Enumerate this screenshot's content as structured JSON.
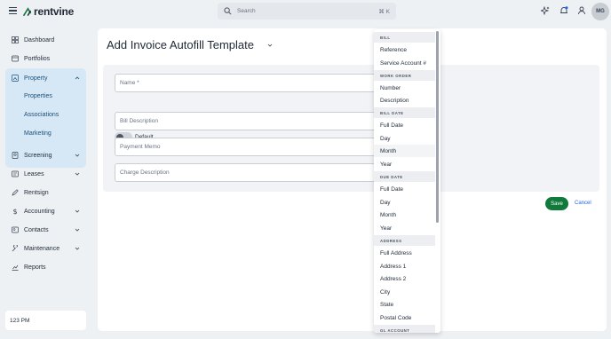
{
  "app": {
    "logo_text": "rentvine",
    "brand_color": "#0f7a3b",
    "accent_color": "#1d4f7a"
  },
  "search": {
    "placeholder": "Search",
    "shortcut": "⌘ K"
  },
  "user": {
    "initials": "MG"
  },
  "sidebar": {
    "items": [
      {
        "label": "Dashboard",
        "icon": "dashboard-icon"
      },
      {
        "label": "Portfolios",
        "icon": "portfolio-icon"
      },
      {
        "label": "Property",
        "icon": "property-icon",
        "expanded": true
      },
      {
        "label": "Screening",
        "icon": "screening-icon"
      },
      {
        "label": "Leases",
        "icon": "leases-icon"
      },
      {
        "label": "Rentsign",
        "icon": "rentsign-icon"
      },
      {
        "label": "Accounting",
        "icon": "dollar-icon"
      },
      {
        "label": "Contacts",
        "icon": "contacts-icon"
      },
      {
        "label": "Maintenance",
        "icon": "wrench-icon"
      },
      {
        "label": "Reports",
        "icon": "reports-icon"
      }
    ],
    "property_sub": [
      "Properties",
      "Associations",
      "Marketing"
    ],
    "footer_text": "123 PM"
  },
  "page": {
    "title": "Add Invoice Autofill Template",
    "fields": {
      "name_placeholder": "Name *",
      "bill_description": "Bill Description",
      "payment_memo": "Payment Memo",
      "charge_description": "Charge Description"
    },
    "default_toggle_label": "Default",
    "default_toggle_on": false,
    "save_label": "Save",
    "cancel_label": "Cancel"
  },
  "dropdown": {
    "groups": [
      {
        "header": "BILL",
        "options": [
          "Reference",
          "Service Account #"
        ]
      },
      {
        "header": "WORK ORDER",
        "options": [
          "Number",
          "Description"
        ]
      },
      {
        "header": "BILL DATE",
        "options": [
          "Full Date",
          "Day",
          "Month",
          "Year"
        ]
      },
      {
        "header": "DUE DATE",
        "options": [
          "Full Date",
          "Day",
          "Month",
          "Year"
        ]
      },
      {
        "header": "ADDRESS",
        "options": [
          "Full Address",
          "Address 1",
          "Address 2",
          "City",
          "State",
          "Postal Code"
        ]
      },
      {
        "header": "GL ACCOUNT",
        "options": []
      }
    ],
    "hovered_option": "Month"
  }
}
